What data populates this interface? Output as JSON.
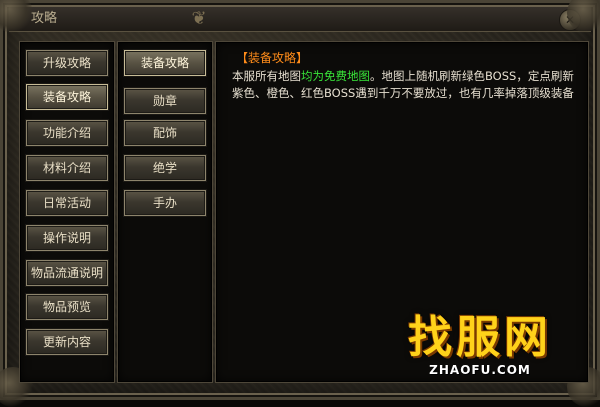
{
  "window": {
    "title": "攻略"
  },
  "categories": [
    {
      "label": "升级攻略",
      "active": false
    },
    {
      "label": "装备攻略",
      "active": true
    },
    {
      "label": "功能介绍",
      "active": false
    },
    {
      "label": "材料介绍",
      "active": false
    },
    {
      "label": "日常活动",
      "active": false
    },
    {
      "label": "操作说明",
      "active": false
    },
    {
      "label": "物品流通说明",
      "active": false
    },
    {
      "label": "物品预览",
      "active": false
    },
    {
      "label": "更新内容",
      "active": false
    }
  ],
  "subcategories": [
    {
      "label": "装备攻略",
      "active": true
    },
    {
      "label": "勋章",
      "active": false
    },
    {
      "label": "配饰",
      "active": false
    },
    {
      "label": "绝学",
      "active": false
    },
    {
      "label": "手办",
      "active": false
    }
  ],
  "content": {
    "title": "【装备攻略】",
    "body_part1": "本服所有地图",
    "body_highlight": "均为免费地图",
    "body_part2": "。地图上随机刷新绿色BOSS，定点刷新紫色、橙色、红色BOSS遇到千万不要放过，也有几率掉落顶级装备"
  },
  "watermark": {
    "main": "找服网",
    "sub": "ZHAOFU.COM"
  },
  "colors": {
    "content_title": "#ff8c1a",
    "highlight": "#39e639",
    "watermark": "#ffd21a"
  }
}
